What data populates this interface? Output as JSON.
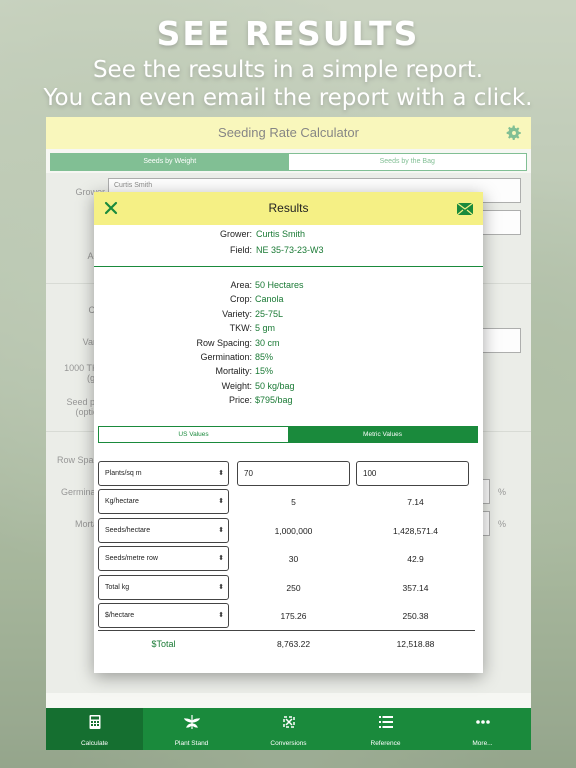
{
  "promo": {
    "headline": "SEE RESULTS",
    "line1": "See the results in a simple report.",
    "line2": "You can even email the report with a click."
  },
  "app": {
    "title": "Seeding Rate Calculator",
    "seg_weight": "Seeds by Weight",
    "seg_bag": "Seeds by the Bag",
    "bg_labels": [
      "Grower",
      "Fi",
      "Ac",
      "Cr",
      "Vari",
      "1000 TK\n(gr",
      "Seed pr\n(optio",
      "Row Spac",
      "Germinat",
      "Morta"
    ],
    "bg_grower_value": "Curtis Smith",
    "percent": "%"
  },
  "results": {
    "title": "Results",
    "grower_label": "Grower:",
    "grower": "Curtis Smith",
    "field_label": "Field:",
    "field": "NE 35-73-23-W3",
    "details": [
      {
        "label": "Area:",
        "value": "50 Hectares"
      },
      {
        "label": "Crop:",
        "value": "Canola"
      },
      {
        "label": "Variety:",
        "value": "25-75L"
      },
      {
        "label": "TKW:",
        "value": "5 gm"
      },
      {
        "label": "Row Spacing:",
        "value": "30 cm"
      },
      {
        "label": "Germination:",
        "value": "85%"
      },
      {
        "label": "Mortality:",
        "value": "15%"
      },
      {
        "label": "Weight:",
        "value": "50 kg/bag"
      },
      {
        "label": "Price:",
        "value": "$795/bag"
      }
    ],
    "units_us": "US Values",
    "units_metric": "Metric Values",
    "first_row": {
      "label": "Plants/sq m",
      "a": "70",
      "b": "100"
    },
    "rows": [
      {
        "label": "Kg/hectare",
        "a": "5",
        "b": "7.14"
      },
      {
        "label": "Seeds/hectare",
        "a": "1,000,000",
        "b": "1,428,571.4"
      },
      {
        "label": "Seeds/metre row",
        "a": "30",
        "b": "42.9"
      },
      {
        "label": "Total kg",
        "a": "250",
        "b": "357.14"
      },
      {
        "label": "$/hectare",
        "a": "175.26",
        "b": "250.38"
      }
    ],
    "total": {
      "label": "$Total",
      "a": "8,763.22",
      "b": "12,518.88"
    }
  },
  "tabs": [
    {
      "label": "Calculate",
      "icon": "calculator-icon"
    },
    {
      "label": "Plant Stand",
      "icon": "plant-icon"
    },
    {
      "label": "Conversions",
      "icon": "conversions-icon"
    },
    {
      "label": "Reference",
      "icon": "list-icon"
    },
    {
      "label": "More...",
      "icon": "more-icon"
    }
  ],
  "colors": {
    "accent": "#1a8a3c",
    "header": "#f5f085",
    "value": "#1a7a35"
  }
}
